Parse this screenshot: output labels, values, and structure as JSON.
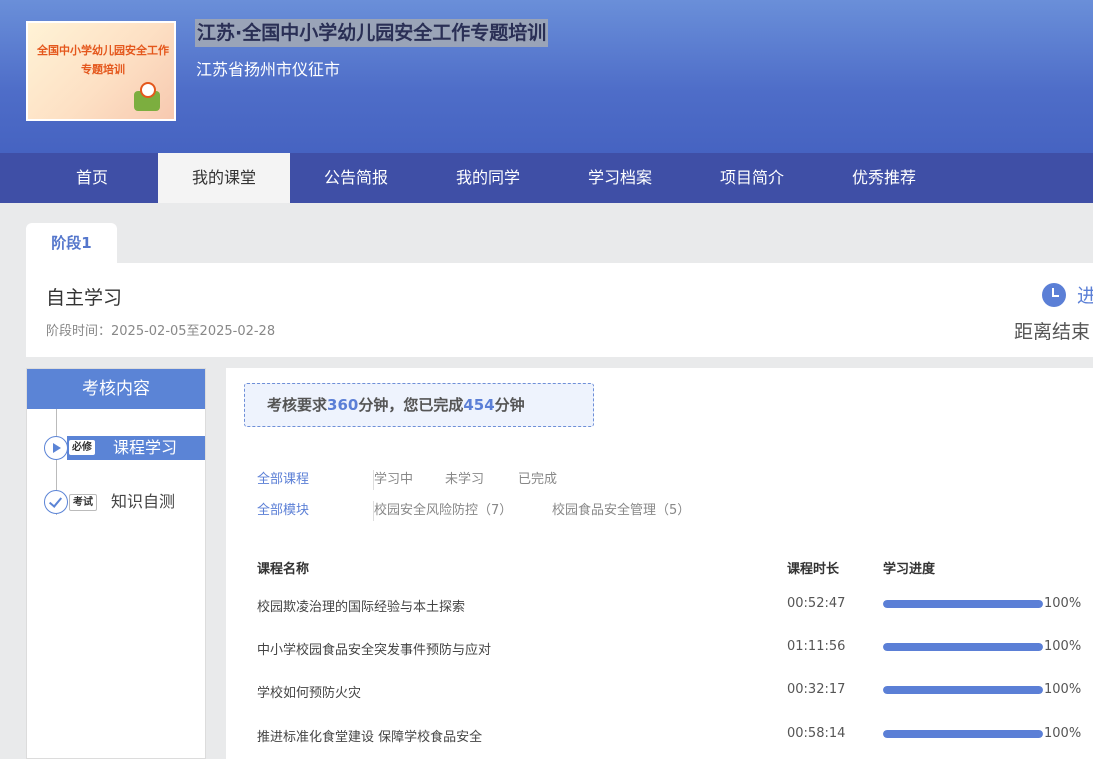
{
  "header": {
    "logo_text": "全国中小学幼儿园安全工作专题培训",
    "title": "江苏·全国中小学幼儿园安全工作专题培训",
    "subtitle": "江苏省扬州市仪征市"
  },
  "nav": {
    "items": [
      "首页",
      "我的课堂",
      "公告简报",
      "我的同学",
      "学习档案",
      "项目简介",
      "优秀推荐"
    ],
    "active": "我的课堂"
  },
  "stage": {
    "tab_label": "阶段1",
    "title": "自主学习",
    "time_label": "阶段时间：2025-02-05至2025-02-28",
    "status_text": "进",
    "countdown_text": "距离结束"
  },
  "sidebar": {
    "header": "考核内容",
    "items": [
      {
        "tag": "必修",
        "label": "课程学习",
        "icon": "play-icon",
        "active": true
      },
      {
        "tag": "考试",
        "label": "知识自测",
        "icon": "check-icon",
        "active": false
      }
    ]
  },
  "requirement": {
    "prefix": "考核要求",
    "required_minutes": "360",
    "middle": "分钟，您已完成",
    "completed_minutes": "454",
    "suffix": "分钟"
  },
  "filters": {
    "status": [
      "全部课程",
      "学习中",
      "未学习",
      "已完成"
    ],
    "modules": [
      "全部模块",
      "校园安全风险防控（7）",
      "校园食品安全管理（5）"
    ]
  },
  "table": {
    "headers": {
      "name": "课程名称",
      "duration": "课程时长",
      "progress": "学习进度"
    },
    "rows": [
      {
        "name": "校园欺凌治理的国际经验与本土探索",
        "duration": "00:52:47",
        "progress": 100,
        "progress_label": "100%"
      },
      {
        "name": "中小学校园食品安全突发事件预防与应对",
        "duration": "01:11:56",
        "progress": 100,
        "progress_label": "100%"
      },
      {
        "name": "学校如何预防火灾",
        "duration": "00:32:17",
        "progress": 100,
        "progress_label": "100%"
      },
      {
        "name": "推进标准化食堂建设 保障学校食品安全",
        "duration": "00:58:14",
        "progress": 100,
        "progress_label": "100%"
      }
    ]
  },
  "colors": {
    "accent": "#5b7fd6",
    "nav_bg": "#3f4fa6"
  }
}
